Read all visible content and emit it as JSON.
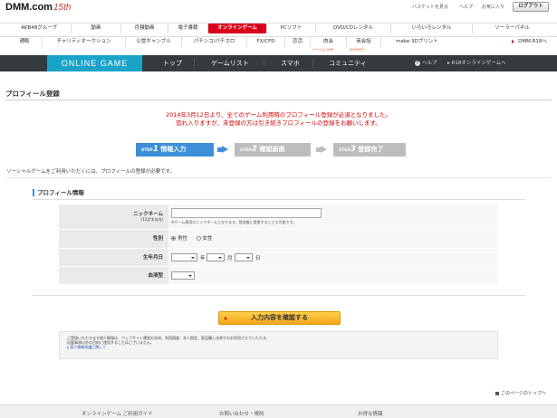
{
  "header": {
    "logo_text": "DMM.com",
    "logo_anniv": "15th",
    "basket": "バスケットを見る",
    "help": "ヘルプ",
    "favorites": "お気に入り",
    "logout": "ログアウト"
  },
  "nav_row1": [
    {
      "label": "AKB48グループ",
      "active": false
    },
    {
      "label": "動画",
      "active": false
    },
    {
      "label": "月額動画",
      "active": false
    },
    {
      "label": "電子書籍",
      "active": false
    },
    {
      "label": "オンラインゲーム",
      "active": true
    },
    {
      "label": "PCソフト",
      "active": false
    },
    {
      "label": "DVD/CDレンタル",
      "active": false
    },
    {
      "label": "いろいろレンタル",
      "active": false
    },
    {
      "label": "ソーラーパネル",
      "active": false
    }
  ],
  "nav_row2": [
    {
      "label": "通販"
    },
    {
      "label": "チャリティオークション"
    },
    {
      "label": "公営ギャンブル"
    },
    {
      "label": "パチンコ/パチスロ"
    },
    {
      "label": "FX/CFD"
    },
    {
      "label": "恋活"
    },
    {
      "label": "肉会"
    },
    {
      "label": "英会話"
    },
    {
      "label": "make 3Dプリント"
    },
    {
      "label": "DMM.R18へ"
    }
  ],
  "nav_sub": {
    "nikukai": "バージョンUP!",
    "eikaiwa": "50%OFF!"
  },
  "game_nav": {
    "logo": "ONLINE GAME",
    "items": [
      "トップ",
      "ゲームリスト",
      "スマホ",
      "コミュニティ"
    ],
    "help": "ヘルプ",
    "r18": "R18オンラインゲームへ"
  },
  "page": {
    "title": "プロフィール登録",
    "notice_line1": "2014年3月12日より、全てのゲーム利用時のプロフィール登録が必須となりました。",
    "notice_line2": "恐れ入りますが、未登録の方は引き続きプロフィールの登録をお願いします。",
    "intro": "ソーシャルゲームをご利用いただくには、プロフィールの登録が必要です。",
    "section_title": "プロフィール情報"
  },
  "steps": [
    {
      "prefix": "STEP",
      "num": "1",
      "label": "情報入力",
      "active": true
    },
    {
      "prefix": "STEP",
      "num": "2",
      "label": "確認画面",
      "active": false
    },
    {
      "prefix": "STEP",
      "num": "3",
      "label": "登録完了",
      "active": false
    }
  ],
  "form": {
    "nickname_label": "ニックネーム",
    "nickname_sub": "(12文字以内)",
    "nickname_value": "",
    "nickname_hint": "※ゲーム専用のニックネームとなります。登録後に変更することも可能です。",
    "gender_label": "性別",
    "gender_male": "男性",
    "gender_female": "女性",
    "gender_selected": "male",
    "birth_label": "生年月日",
    "birth_year_unit": "年",
    "birth_month_unit": "月",
    "birth_day_unit": "日",
    "blood_label": "血液型"
  },
  "submit_label": "入力内容を確認する",
  "privacy": {
    "line1": "ご登録いただきます個人情報は、ウェブサイト運営の告知、利用調査、本人照会、懸品購入決済でのお利用させていただき、",
    "line2": "記載事項以外の目的に使用することはございません。",
    "link": "個人情報保護に関して"
  },
  "page_top": "このページのトップへ",
  "footer": [
    "オンラインゲーム ご利用ガイド",
    "お問い合わせ・規約",
    "お得な情報"
  ]
}
